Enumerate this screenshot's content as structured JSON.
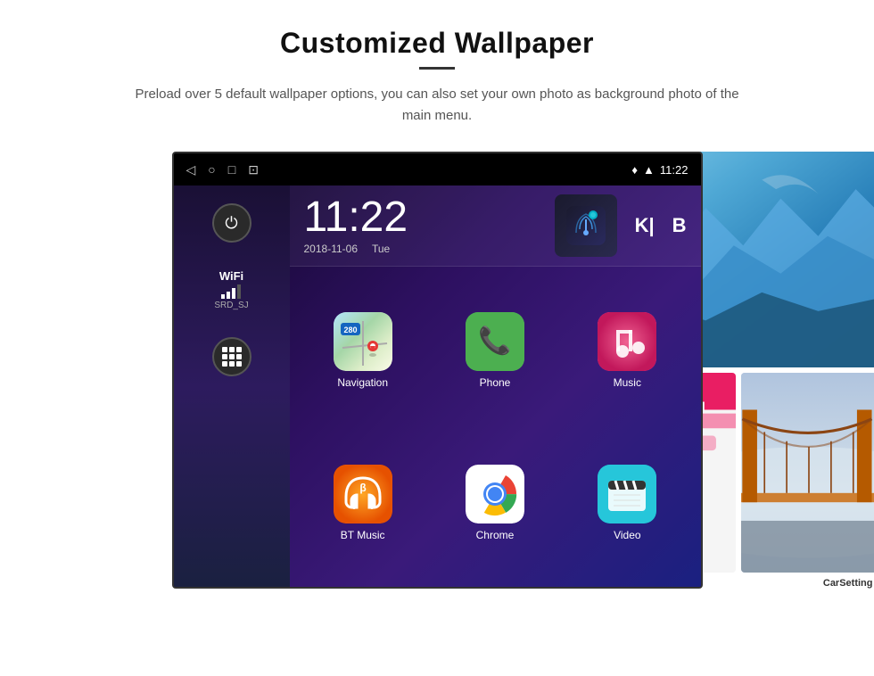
{
  "header": {
    "title": "Customized Wallpaper",
    "subtitle": "Preload over 5 default wallpaper options, you can also set your own photo as background photo of the main menu."
  },
  "statusBar": {
    "time": "11:22",
    "icons": {
      "back": "◁",
      "home": "○",
      "recents": "□",
      "screenshot": "⊡"
    }
  },
  "timeWidget": {
    "clock": "11:22",
    "date": "2018-11-06",
    "day": "Tue"
  },
  "wifi": {
    "label": "WiFi",
    "ssid": "SRD_SJ"
  },
  "apps": [
    {
      "name": "Navigation",
      "icon": "maps"
    },
    {
      "name": "Phone",
      "icon": "phone"
    },
    {
      "name": "Music",
      "icon": "music"
    },
    {
      "name": "BT Music",
      "icon": "bt"
    },
    {
      "name": "Chrome",
      "icon": "chrome"
    },
    {
      "name": "Video",
      "icon": "video"
    }
  ],
  "wallpapers": [
    {
      "name": "CarSetting",
      "type": "carsetting"
    }
  ]
}
